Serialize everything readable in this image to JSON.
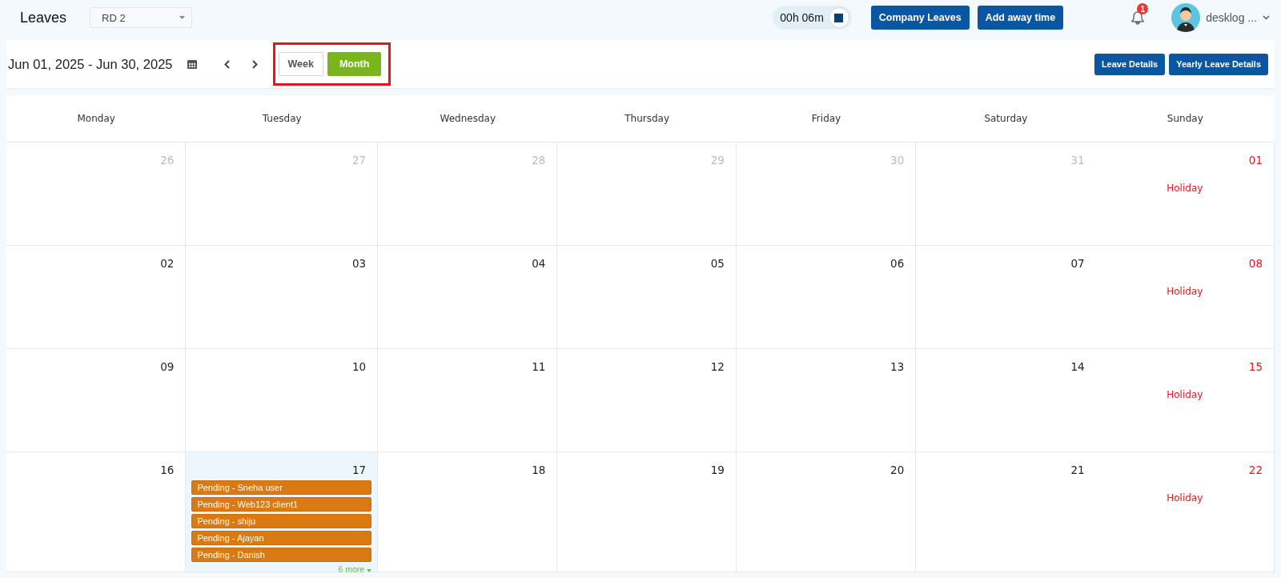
{
  "header": {
    "title": "Leaves",
    "team_select": {
      "value": "RD 2"
    },
    "timer": "00h 06m",
    "buttons": [
      "Company Leaves",
      "Add away time"
    ],
    "notifications": {
      "count": "1"
    },
    "user": {
      "name": "desklog ..."
    }
  },
  "toolbar": {
    "date_range": "Jun 01, 2025 - Jun 30, 2025",
    "views": [
      {
        "label": "Week",
        "selected": false
      },
      {
        "label": "Month",
        "selected": true
      }
    ],
    "actions": [
      "Leave Details",
      "Yearly Leave Details"
    ]
  },
  "calendar": {
    "weekdays": [
      "Monday",
      "Tuesday",
      "Wednesday",
      "Thursday",
      "Friday",
      "Saturday",
      "Sunday"
    ],
    "weeks": [
      [
        {
          "number": "26",
          "kind": "outside"
        },
        {
          "number": "27",
          "kind": "outside"
        },
        {
          "number": "28",
          "kind": "outside"
        },
        {
          "number": "29",
          "kind": "outside"
        },
        {
          "number": "30",
          "kind": "outside"
        },
        {
          "number": "31",
          "kind": "outside"
        },
        {
          "number": "01",
          "kind": "holiday",
          "note": "Holiday"
        }
      ],
      [
        {
          "number": "02",
          "kind": "regular"
        },
        {
          "number": "03",
          "kind": "regular"
        },
        {
          "number": "04",
          "kind": "regular"
        },
        {
          "number": "05",
          "kind": "regular"
        },
        {
          "number": "06",
          "kind": "regular"
        },
        {
          "number": "07",
          "kind": "regular"
        },
        {
          "number": "08",
          "kind": "holiday",
          "note": "Holiday"
        }
      ],
      [
        {
          "number": "09",
          "kind": "regular"
        },
        {
          "number": "10",
          "kind": "regular"
        },
        {
          "number": "11",
          "kind": "regular"
        },
        {
          "number": "12",
          "kind": "regular"
        },
        {
          "number": "13",
          "kind": "regular"
        },
        {
          "number": "14",
          "kind": "regular"
        },
        {
          "number": "15",
          "kind": "holiday",
          "note": "Holiday"
        }
      ],
      [
        {
          "number": "16",
          "kind": "regular"
        },
        {
          "number": "17",
          "kind": "today",
          "events": [
            "Pending - Sneha user",
            "Pending - Web123 client1",
            "Pending - shiju",
            "Pending - Ajayan",
            "Pending - Danish"
          ],
          "more": "6 more"
        },
        {
          "number": "18",
          "kind": "regular"
        },
        {
          "number": "19",
          "kind": "regular"
        },
        {
          "number": "20",
          "kind": "regular"
        },
        {
          "number": "21",
          "kind": "regular"
        },
        {
          "number": "22",
          "kind": "holiday",
          "note": "Holiday"
        }
      ]
    ]
  }
}
